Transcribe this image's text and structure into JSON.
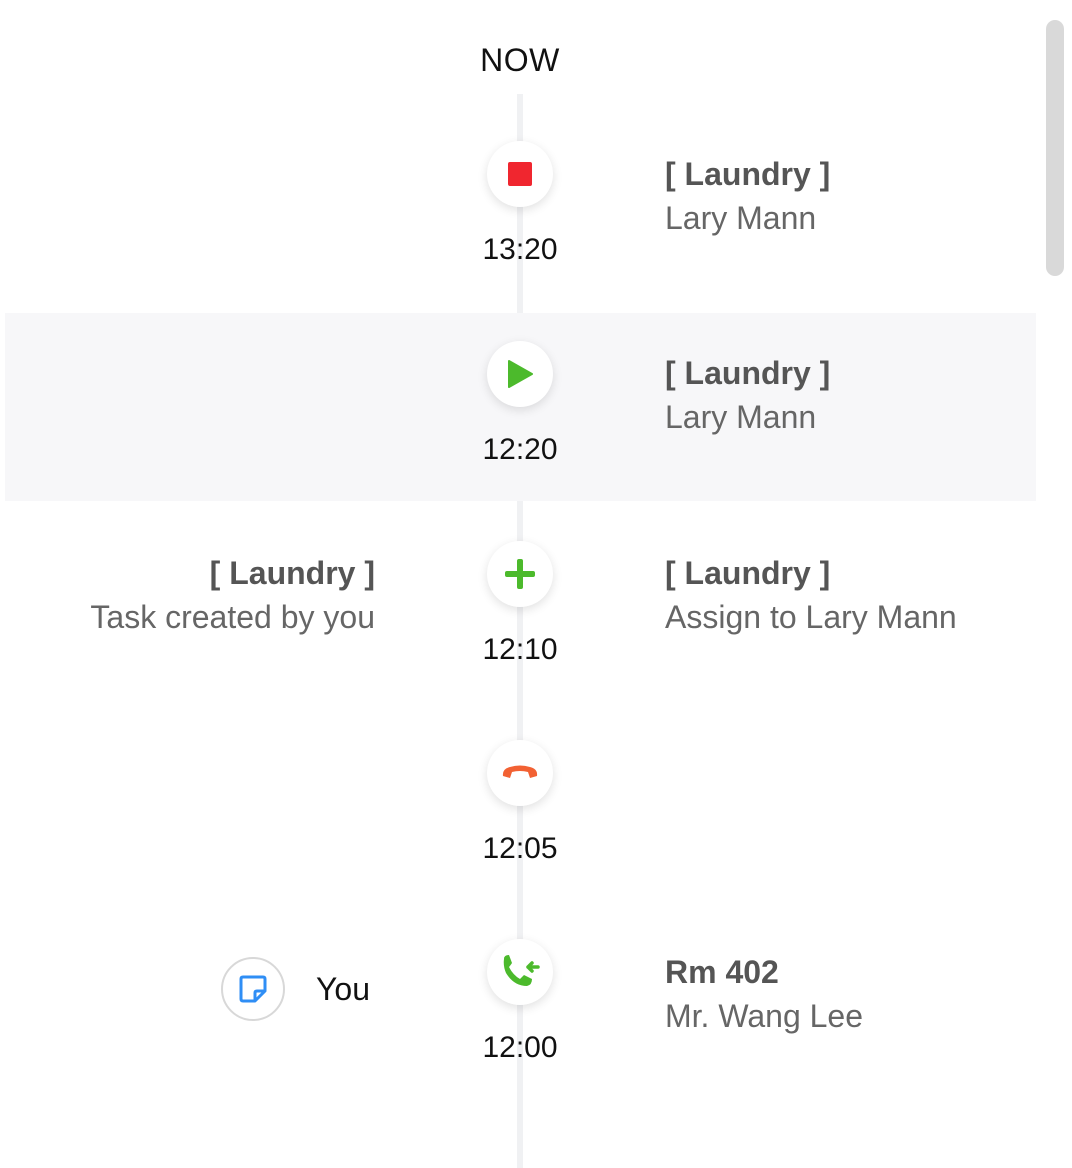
{
  "timeline": {
    "now_label": "NOW",
    "events": [
      {
        "time": "13:20",
        "icon": "stop-icon",
        "icon_color": "#f0262f",
        "right_title": "[ Laundry ]",
        "right_sub": "Lary Mann"
      },
      {
        "time": "12:20",
        "icon": "play-icon",
        "icon_color": "#4cba2c",
        "right_title": "[ Laundry ]",
        "right_sub": "Lary Mann",
        "highlighted": true
      },
      {
        "time": "12:10",
        "icon": "plus-icon",
        "icon_color": "#4cba2c",
        "left_title": "[ Laundry ]",
        "left_sub": "Task created by you",
        "right_title": "[ Laundry ]",
        "right_sub": "Assign to Lary Mann"
      },
      {
        "time": "12:05",
        "icon": "hang-up-phone-icon",
        "icon_color": "#f26133"
      },
      {
        "time": "12:00",
        "icon": "incoming-call-icon",
        "icon_color": "#4cba2c",
        "left_note_icon": "note-icon",
        "left_note_color": "#2f8ef5",
        "left_label": "You",
        "right_title": "Rm 402",
        "right_sub": "Mr. Wang Lee"
      }
    ]
  }
}
